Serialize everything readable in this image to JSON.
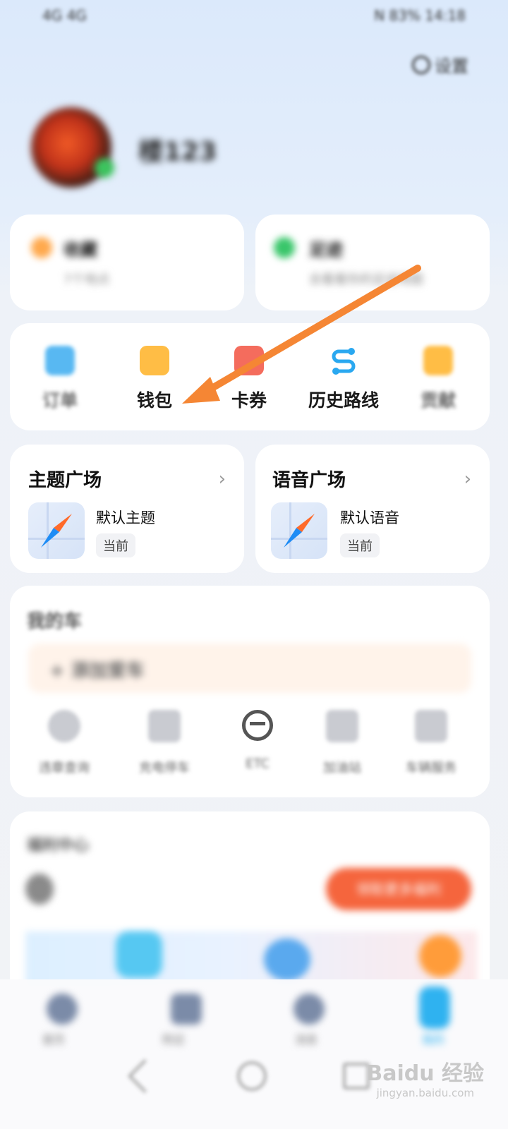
{
  "status": {
    "left": "4G 4G",
    "right": "N 83% 14:18"
  },
  "header": {
    "settings_label": "设置"
  },
  "profile": {
    "name": "楼123"
  },
  "top_cards": [
    {
      "title": "收藏",
      "subtitle": "7个地点"
    },
    {
      "title": "足迹",
      "subtitle": "去看看你的足迹地图"
    }
  ],
  "quick": [
    {
      "label": "订单",
      "icon": "order-icon"
    },
    {
      "label": "钱包",
      "icon": "wallet-icon"
    },
    {
      "label": "卡券",
      "icon": "coupon-icon"
    },
    {
      "label": "历史路线",
      "icon": "route-icon"
    },
    {
      "label": "贡献",
      "icon": "contribution-icon"
    }
  ],
  "theme_card": {
    "title": "主题广场",
    "item": "默认主题",
    "badge": "当前"
  },
  "voice_card": {
    "title": "语音广场",
    "item": "默认语音",
    "badge": "当前"
  },
  "car": {
    "title": "我的车",
    "add": "+ 添加爱车",
    "tools": [
      "违章查询",
      "充电停车",
      "ETC",
      "加油站",
      "车辆服务"
    ]
  },
  "task": {
    "title": "福利中心",
    "button": "领取更多福利"
  },
  "bottom_nav": [
    "首页",
    "附近",
    "消息",
    "我的"
  ],
  "watermark": {
    "brand": "Baidu 经验",
    "url": "jingyan.baidu.com"
  },
  "colors": {
    "accent": "#ff8a3d",
    "route_blue": "#2aa8f0"
  }
}
